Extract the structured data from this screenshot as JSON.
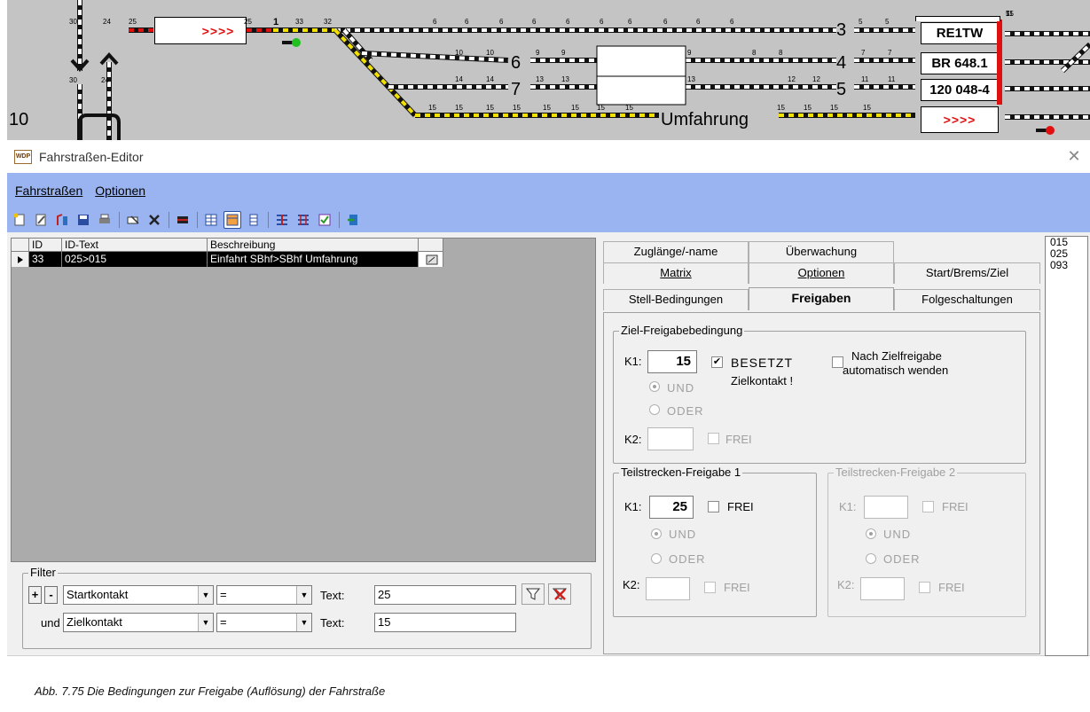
{
  "track": {
    "area_label": "10",
    "track_numbers": [
      "3",
      "4",
      "5",
      "6",
      "7"
    ],
    "umfahrung_label": "Umfahrung",
    "signal_arrows": ">>>>",
    "trains": [
      "RE1TW",
      "BR 648.1",
      "120 048-4"
    ],
    "small_numbers": {
      "left_top": [
        "30",
        "24",
        "25"
      ],
      "left_mid": [
        "30",
        "24"
      ],
      "sig_area": [
        "25",
        "1",
        "33",
        "32"
      ],
      "row1": [
        "6",
        "6",
        "6",
        "6",
        "6",
        "6",
        "6",
        "6",
        "6",
        "6"
      ],
      "row1b": [
        "5",
        "5"
      ],
      "row2": [
        "10",
        "10",
        "9",
        "9",
        "9",
        "8",
        "8",
        "7",
        "7"
      ],
      "row3": [
        "14",
        "14",
        "13",
        "13",
        "13",
        "12",
        "12",
        "11",
        "11"
      ],
      "row4": [
        "15",
        "15",
        "15",
        "15",
        "15",
        "15",
        "15",
        "15",
        "15",
        "15",
        "15",
        "15"
      ],
      "right": [
        "5",
        "7",
        "11",
        "15"
      ]
    }
  },
  "window": {
    "title": "Fahrstraßen-Editor",
    "icon_text": "WDP",
    "close_symbol": "✕",
    "menu": [
      {
        "label": "Fahrstraßen"
      },
      {
        "label": "Optionen"
      }
    ],
    "toolbar_icons": [
      "new-icon",
      "edit-icon",
      "copy-icon",
      "save-icon",
      "print-icon",
      "rename-icon",
      "delete-icon",
      "block-icon",
      "grid-icon",
      "grid-active-icon",
      "column-icon",
      "route-icon",
      "route-list-icon",
      "check-icon",
      "exit-icon"
    ]
  },
  "grid": {
    "headers": [
      "ID",
      "ID-Text",
      "Beschreibung"
    ],
    "rows": [
      {
        "id": "33",
        "id_text": "025>015",
        "beschreibung": "Einfahrt SBhf>SBhf Umfahrung"
      }
    ]
  },
  "filter": {
    "label": "Filter",
    "plus": "+",
    "minus": "-",
    "und_label": "und",
    "rows": [
      {
        "field": "Startkontakt",
        "op": "=",
        "text_label": "Text:",
        "value": "25"
      },
      {
        "field": "Zielkontakt",
        "op": "=",
        "text_label": "Text:",
        "value": "15"
      }
    ]
  },
  "tabs": {
    "row1": [
      "Zuglänge/-name",
      "Überwachung"
    ],
    "row2": [
      "Matrix",
      "Optionen",
      "Start/Brems/Ziel"
    ],
    "row3": [
      "Stell-Bedingungen",
      "Freigaben",
      "Folgeschaltungen"
    ],
    "active": "Freigaben"
  },
  "freigaben": {
    "ziel_group": "Ziel-Freigabebedingung",
    "k1_label": "K1:",
    "k2_label": "K2:",
    "ziel_k1": "15",
    "besetzt_checked": true,
    "besetzt_label": "BESETZT",
    "zielkontakt_label": "Zielkontakt !",
    "nach_ziel_label_1": "Nach Zielfreigabe",
    "nach_ziel_label_2": "automatisch wenden",
    "und_label": "UND",
    "oder_label": "ODER",
    "frei_label": "FREI",
    "teil1_group": "Teilstrecken-Freigabe 1",
    "teil1_k1": "25",
    "teil2_group": "Teilstrecken-Freigabe 2"
  },
  "id_list": [
    "015",
    "025",
    "093"
  ],
  "caption": "Abb. 7.75    Die Bedingungen zur Freigabe (Auflösung) der Fahrstraße"
}
